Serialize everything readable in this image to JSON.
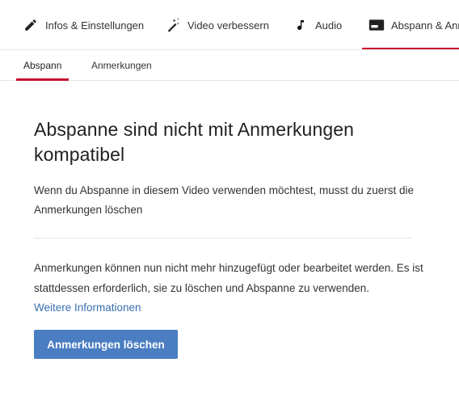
{
  "top_tabs": [
    {
      "label": "Infos & Einstellungen",
      "icon": "pencil-icon"
    },
    {
      "label": "Video verbessern",
      "icon": "magic-wand-icon"
    },
    {
      "label": "Audio",
      "icon": "music-note-icon"
    },
    {
      "label": "Abspann & Anmerkungen",
      "icon": "end-screen-icon",
      "active": true
    }
  ],
  "sub_tabs": [
    {
      "label": "Abspann",
      "active": true
    },
    {
      "label": "Anmerkungen"
    }
  ],
  "notice": {
    "heading": "Abspanne sind nicht mit Anmerkungen kompatibel",
    "description": "Wenn du Abspanne in diesem Video verwenden möchtest, musst du zuerst die Anmerkungen löschen",
    "info": "Anmerkungen können nun nicht mehr hinzugefügt oder bearbeitet werden. Es ist stattdessen erforderlich, sie zu löschen und Abspanne zu verwenden.",
    "more_link": "Weitere Informationen",
    "button_label": "Anmerkungen löschen"
  },
  "colors": {
    "accent": "#c8102e",
    "button": "#4a7dc1",
    "link": "#3a6fb0"
  }
}
